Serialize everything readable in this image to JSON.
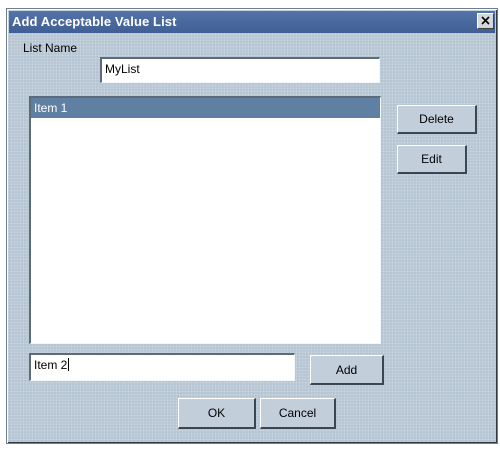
{
  "window": {
    "title": "Add Acceptable Value List",
    "close_icon": "close-icon"
  },
  "form": {
    "list_name_label": "List Name",
    "list_name_value": "MyList",
    "list_items": [
      "Item 1"
    ],
    "selected_index": 0,
    "new_item_value": "Item 2"
  },
  "buttons": {
    "delete": "Delete",
    "edit": "Edit",
    "add": "Add",
    "ok": "OK",
    "cancel": "Cancel"
  },
  "colors": {
    "titlebar": "#4a6a9f",
    "dialog_bg": "#b8c7d5",
    "selection": "#5f7fa3"
  }
}
